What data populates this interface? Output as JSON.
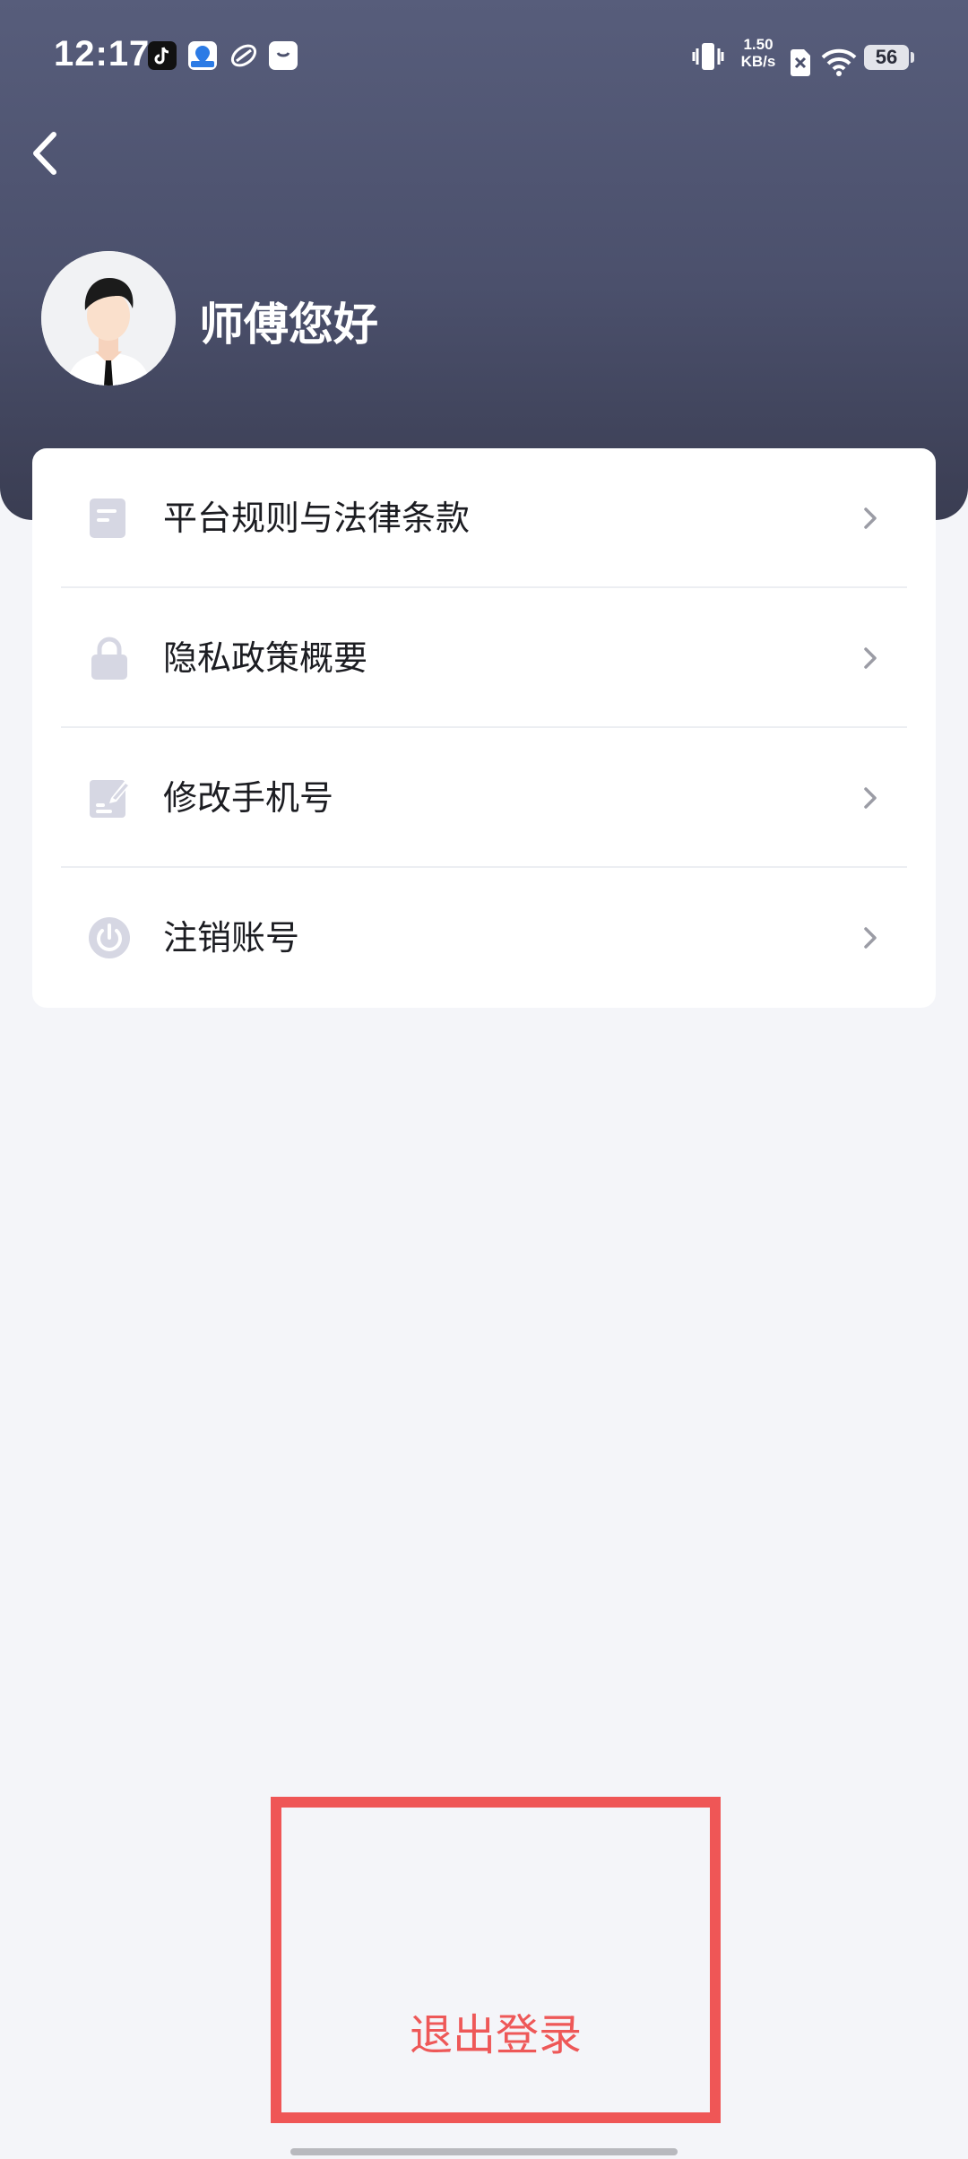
{
  "status_bar": {
    "time": "12:17",
    "net_speed_value": "1.50",
    "net_speed_unit": "KB/s",
    "battery": "56",
    "icons": [
      "douyin-app-icon",
      "map-app-icon",
      "sync-app-icon",
      "bag-app-icon",
      "vibrate-icon",
      "sim-disabled-icon",
      "wifi-icon",
      "battery-icon"
    ]
  },
  "header": {
    "back_icon": "chevron-left-icon",
    "greeting": "师傅您好",
    "avatar": "driver-avatar"
  },
  "menu": {
    "items": [
      {
        "label": "平台规则与法律条款",
        "icon": "document-icon"
      },
      {
        "label": "隐私政策概要",
        "icon": "lock-icon"
      },
      {
        "label": "修改手机号",
        "icon": "edit-icon"
      },
      {
        "label": "注销账号",
        "icon": "power-icon"
      }
    ]
  },
  "logout": {
    "label": "退出登录"
  },
  "colors": {
    "header_top": "#575d7b",
    "header_bottom": "#3a3d52",
    "page_bg": "#f4f5f9",
    "icon_tint": "#d6d7e3",
    "logout_text": "#ee5858",
    "highlight_frame": "#ef5656"
  }
}
